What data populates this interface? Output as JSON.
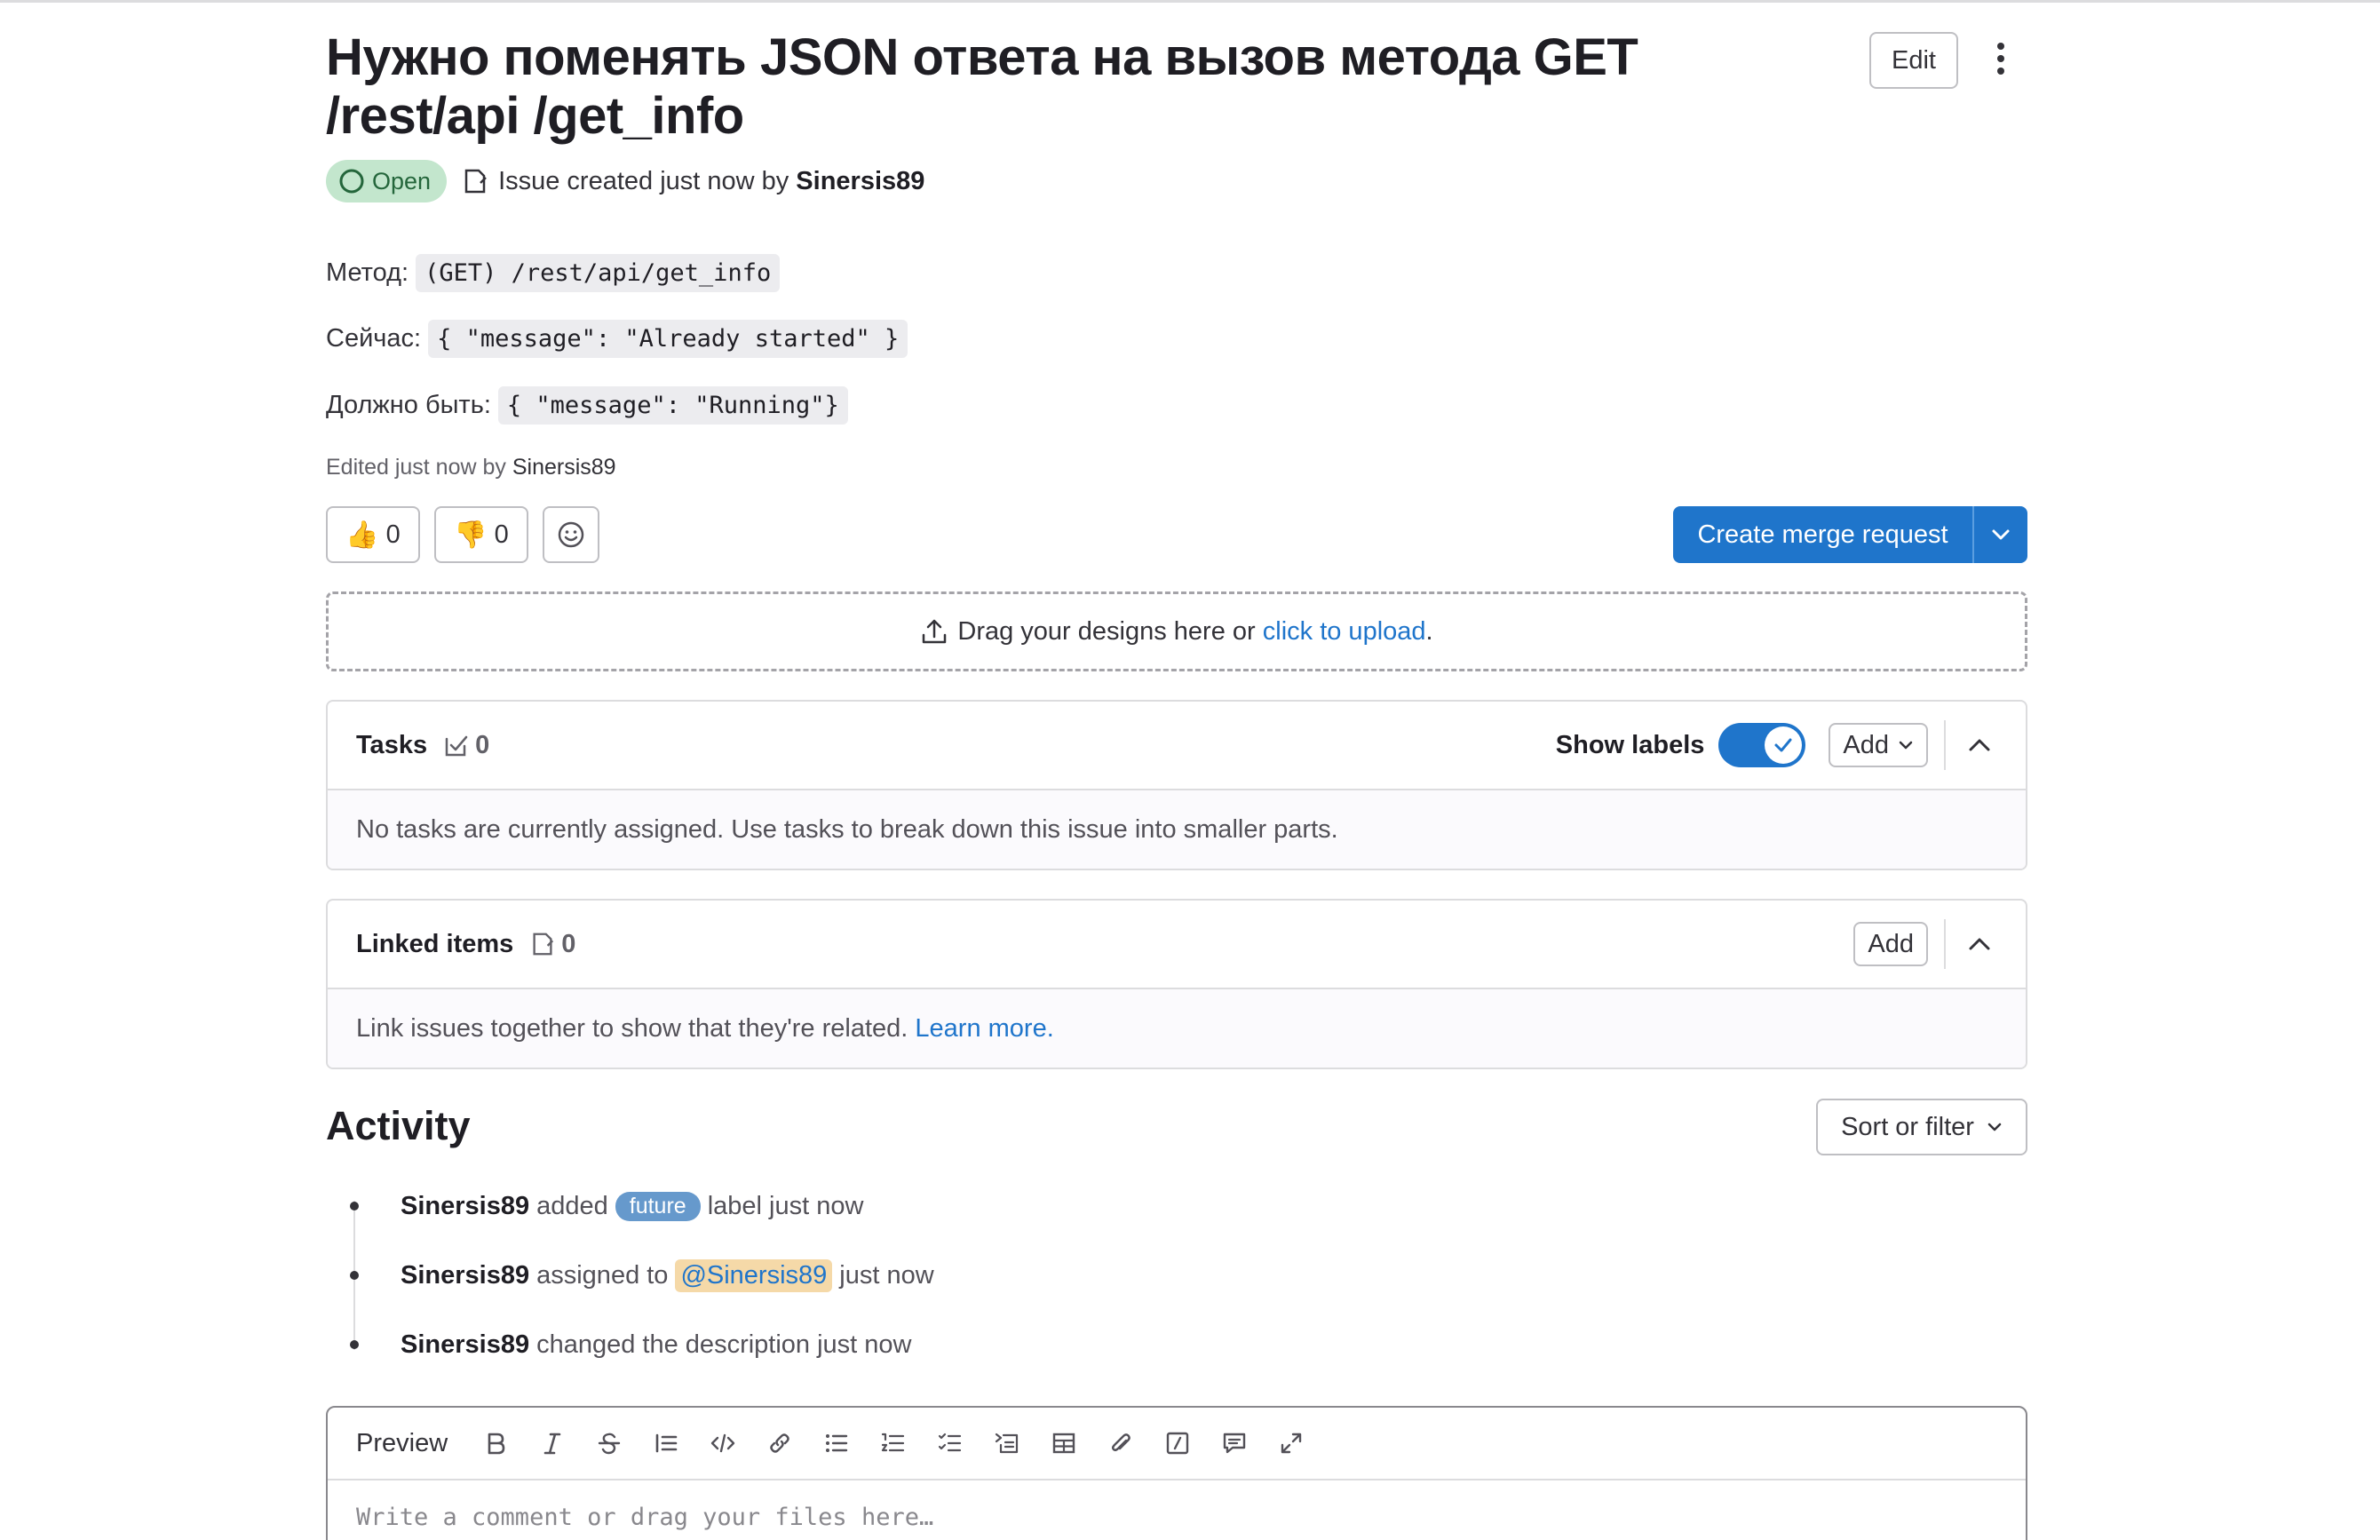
{
  "issue": {
    "title": "Нужно поменять JSON ответа на вызов метода GET /rest/api /get_info",
    "status": "Open",
    "meta_prefix": "Issue created just now by",
    "author": "Sinersis89",
    "edit_label": "Edit"
  },
  "description": {
    "lines": [
      {
        "label": "Метод:",
        "code": "(GET) /rest/api/get_info"
      },
      {
        "label": "Сейчас:",
        "code": "{ \"message\": \"Already started\" }"
      },
      {
        "label": "Должно быть:",
        "code": "{ \"message\": \"Running\"}"
      }
    ],
    "edited_prefix": "Edited just now by",
    "edited_by": "Sinersis89"
  },
  "reactions": {
    "thumbs_up": {
      "emoji": "👍",
      "count": "0"
    },
    "thumbs_down": {
      "emoji": "👎",
      "count": "0"
    }
  },
  "merge_request": {
    "label": "Create merge request"
  },
  "design_upload": {
    "text": "Drag your designs here or",
    "link": "click to upload",
    "suffix": "."
  },
  "tasks": {
    "title": "Tasks",
    "count": "0",
    "show_labels": "Show labels",
    "show_labels_on": true,
    "add_label": "Add",
    "empty_text": "No tasks are currently assigned. Use tasks to break down this issue into smaller parts."
  },
  "linked_items": {
    "title": "Linked items",
    "count": "0",
    "add_label": "Add",
    "empty_text": "Link issues together to show that they're related.",
    "learn_more": "Learn more."
  },
  "activity": {
    "title": "Activity",
    "sort_label": "Sort or filter",
    "items": [
      {
        "author": "Sinersis89",
        "pre": "added",
        "label": "future",
        "post": "label just now"
      },
      {
        "author": "Sinersis89",
        "pre": "assigned to",
        "mention": "@Sinersis89",
        "post": "just now"
      },
      {
        "author": "Sinersis89",
        "pre": "changed the description just now"
      }
    ]
  },
  "comment_editor": {
    "preview_label": "Preview",
    "placeholder": "Write a comment or drag your files here…",
    "tools": [
      "bold-icon",
      "italic-icon",
      "strikethrough-icon",
      "quote-icon",
      "code-icon",
      "link-icon",
      "bullet-list-icon",
      "numbered-list-icon",
      "task-list-icon",
      "collapsible-section-icon",
      "table-icon",
      "attach-file-icon",
      "slash-command-icon",
      "comment-template-icon",
      "fullscreen-icon"
    ]
  },
  "colors": {
    "primary": "#1f75cb",
    "open_badge_bg": "#c3e6cd",
    "open_badge_text": "#24663b",
    "label_future": "#6699cc",
    "mention_bg": "#f5d9a8"
  }
}
